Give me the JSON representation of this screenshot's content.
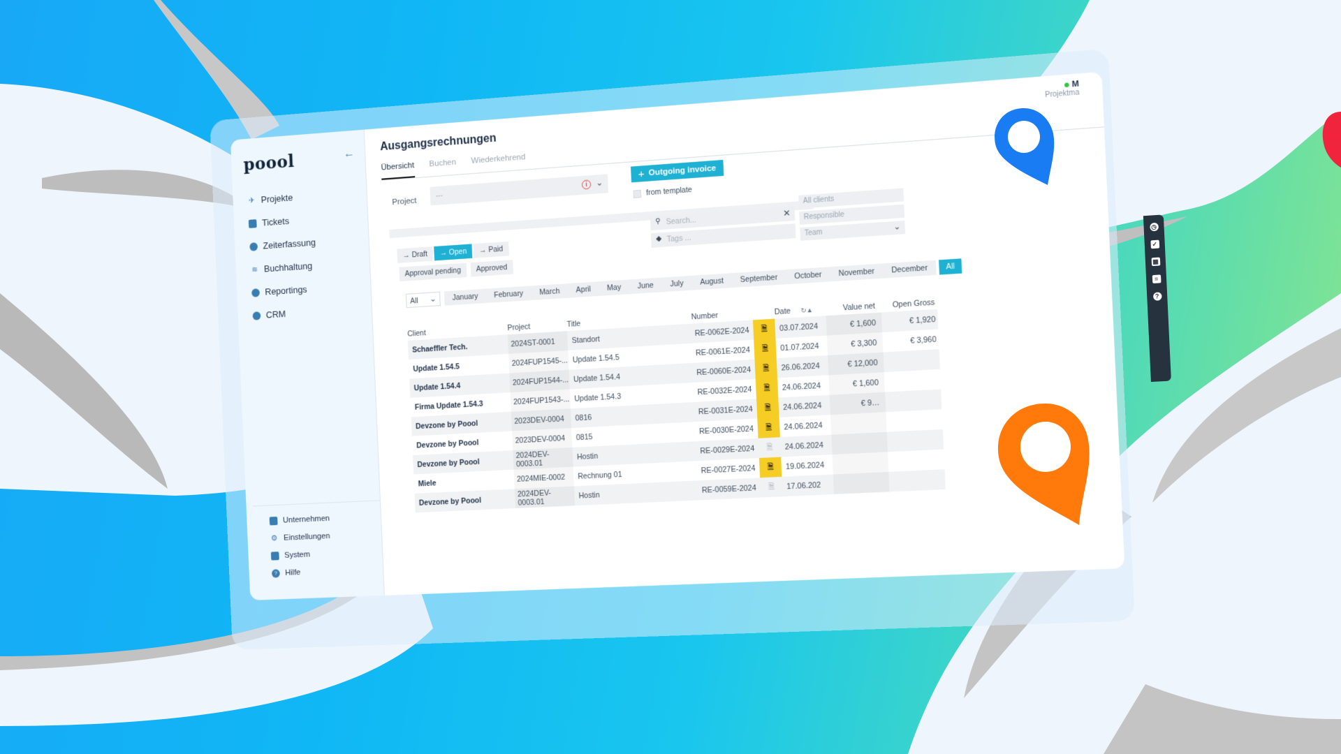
{
  "app": {
    "logo": "poool",
    "collapse_icon": "arrow-left-icon"
  },
  "sidebar": {
    "items": [
      {
        "label": "Projekte",
        "icon": "rocket-icon"
      },
      {
        "label": "Tickets",
        "icon": "ticket-icon"
      },
      {
        "label": "Zeiterfassung",
        "icon": "clock-icon"
      },
      {
        "label": "Buchhaltung",
        "icon": "coins-icon"
      },
      {
        "label": "Reportings",
        "icon": "pie-chart-icon"
      },
      {
        "label": "CRM",
        "icon": "users-icon"
      }
    ],
    "bottom_items": [
      {
        "label": "Unternehmen",
        "icon": "briefcase-icon"
      },
      {
        "label": "Einstellungen",
        "icon": "gear-icon"
      },
      {
        "label": "System",
        "icon": "sliders-icon"
      },
      {
        "label": "Hilfe",
        "icon": "help-icon"
      }
    ]
  },
  "header": {
    "title": "Ausgangsrechnungen",
    "user_initial": "M",
    "user_role": "Projektma",
    "status_color": "#35c24a"
  },
  "tabs": [
    {
      "label": "Übersicht",
      "active": true
    },
    {
      "label": "Buchen",
      "active": false
    },
    {
      "label": "Wiederkehrend",
      "active": false
    }
  ],
  "project_filter": {
    "label": "Project",
    "value": "---"
  },
  "actions": {
    "outgoing_invoice_label": "Outgoing invoice",
    "from_template_label": "from template"
  },
  "status_filters": {
    "row1": [
      {
        "label": "→ Draft",
        "active": false
      },
      {
        "label": "→ Open",
        "active": true
      },
      {
        "label": "→ Paid",
        "active": false
      }
    ],
    "row2": [
      {
        "label": "Approval pending"
      },
      {
        "label": "Approved"
      }
    ]
  },
  "search": {
    "placeholder": "Search...",
    "tags_placeholder": "Tags ..."
  },
  "dropdowns": {
    "clients": "All clients",
    "responsible": "Responsible",
    "team": "Team"
  },
  "period": {
    "year_select": "All",
    "months": [
      "January",
      "February",
      "March",
      "April",
      "May",
      "June",
      "July",
      "August",
      "September",
      "October",
      "November",
      "December"
    ],
    "all_label": "All"
  },
  "table": {
    "columns": [
      "Client",
      "Project",
      "Title",
      "Number",
      "",
      "Date",
      "Value net",
      "Open Gross"
    ],
    "rows": [
      {
        "client": "Schaeffler Tech.",
        "project": "2024ST-0001",
        "title": "Standort",
        "number": "RE-0062E-2024",
        "pdf": true,
        "date": "03.07.2024",
        "value_net": "€ 1,600",
        "open_gross": "€ 1,920"
      },
      {
        "client": "Update 1.54.5",
        "project": "2024FUP1545-...",
        "title": "Update 1.54.5",
        "number": "RE-0061E-2024",
        "pdf": true,
        "date": "01.07.2024",
        "value_net": "€ 3,300",
        "open_gross": "€ 3,960"
      },
      {
        "client": "Update 1.54.4",
        "project": "2024FUP1544-...",
        "title": "Update 1.54.4",
        "number": "RE-0060E-2024",
        "pdf": true,
        "date": "26.06.2024",
        "value_net": "€ 12,000",
        "open_gross": ""
      },
      {
        "client": "Firma Update 1.54.3",
        "project": "2024FUP1543-...",
        "title": "Update 1.54.3",
        "number": "RE-0032E-2024",
        "pdf": true,
        "date": "24.06.2024",
        "value_net": "€ 1,600",
        "open_gross": ""
      },
      {
        "client": "Devzone by Poool",
        "project": "2023DEV-0004",
        "title": "0816",
        "number": "RE-0031E-2024",
        "pdf": true,
        "date": "24.06.2024",
        "value_net": "€ 9…",
        "open_gross": ""
      },
      {
        "client": "Devzone by Poool",
        "project": "2023DEV-0004",
        "title": "0815",
        "number": "RE-0030E-2024",
        "pdf": true,
        "date": "24.06.2024",
        "value_net": "",
        "open_gross": ""
      },
      {
        "client": "Devzone by Poool",
        "project": "2024DEV-0003.01",
        "title": "Hostin",
        "number": "RE-0029E-2024",
        "pdf": false,
        "date": "24.06.2024",
        "value_net": "",
        "open_gross": ""
      },
      {
        "client": "Miele",
        "project": "2024MIE-0002",
        "title": "Rechnung 01",
        "number": "RE-0027E-2024",
        "pdf": true,
        "date": "19.06.2024",
        "value_net": "",
        "open_gross": ""
      },
      {
        "client": "Devzone by Poool",
        "project": "2024DEV-0003.01",
        "title": "Hostin",
        "number": "RE-0059E-2024",
        "pdf": false,
        "date": "17.06.202",
        "value_net": "",
        "open_gross": ""
      }
    ]
  },
  "rail_icons": [
    "clock-icon",
    "checkbox-icon",
    "calendar-icon",
    "task-list-icon",
    "help-icon"
  ],
  "colors": {
    "accent": "#1eb1d3",
    "pdf_highlight": "#f5cd25",
    "pin_blue": "#1a7cf2",
    "pin_orange": "#ff7a0a",
    "pin_red": "#f0243c"
  }
}
